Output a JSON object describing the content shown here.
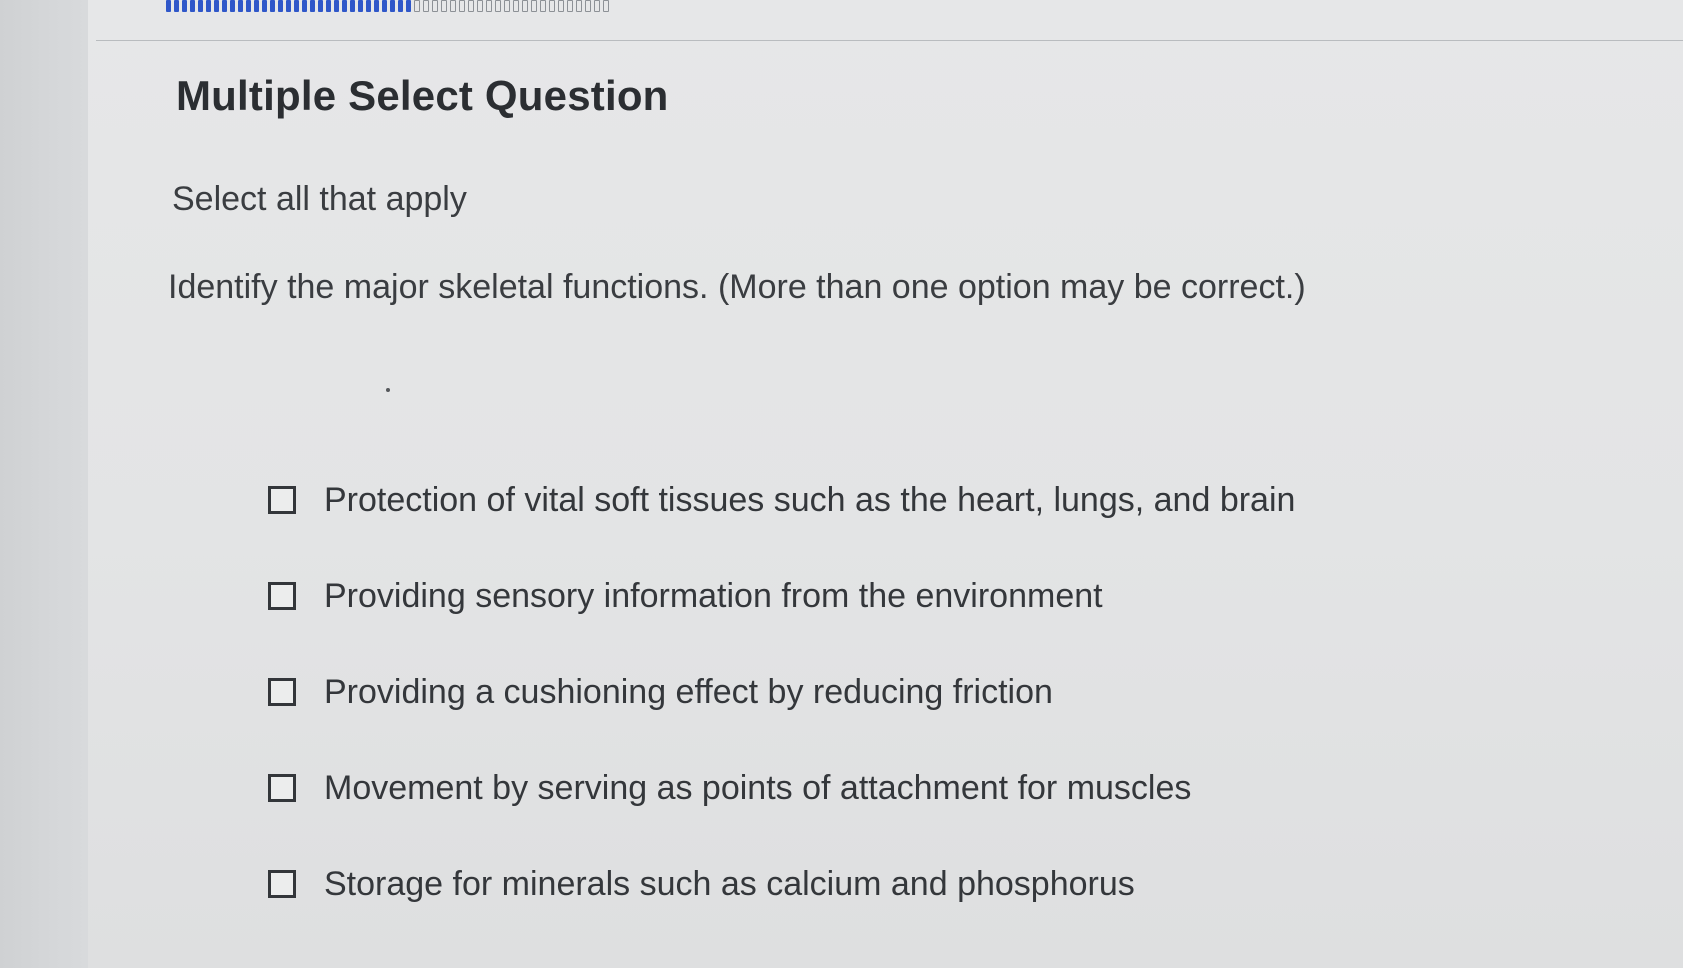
{
  "progress": {
    "completed_fraction": 0.58,
    "filled_segments": 31,
    "total_segments": 53
  },
  "question": {
    "title": "Multiple Select Question",
    "instruction": "Select all that apply",
    "prompt": "Identify the major skeletal functions. (More than one option may be correct.)",
    "options": [
      {
        "label": "Protection of vital soft tissues such as the heart, lungs, and brain",
        "checked": false
      },
      {
        "label": "Providing sensory information from the environment",
        "checked": false
      },
      {
        "label": "Providing a cushioning effect by reducing friction",
        "checked": false
      },
      {
        "label": "Movement by serving as points of attachment for muscles",
        "checked": false
      },
      {
        "label": "Storage for minerals such as calcium and phosphorus",
        "checked": false
      }
    ]
  },
  "colors": {
    "progress_fill": "#2f57c9",
    "text": "#2e3135",
    "background": "#e4e5e6"
  }
}
